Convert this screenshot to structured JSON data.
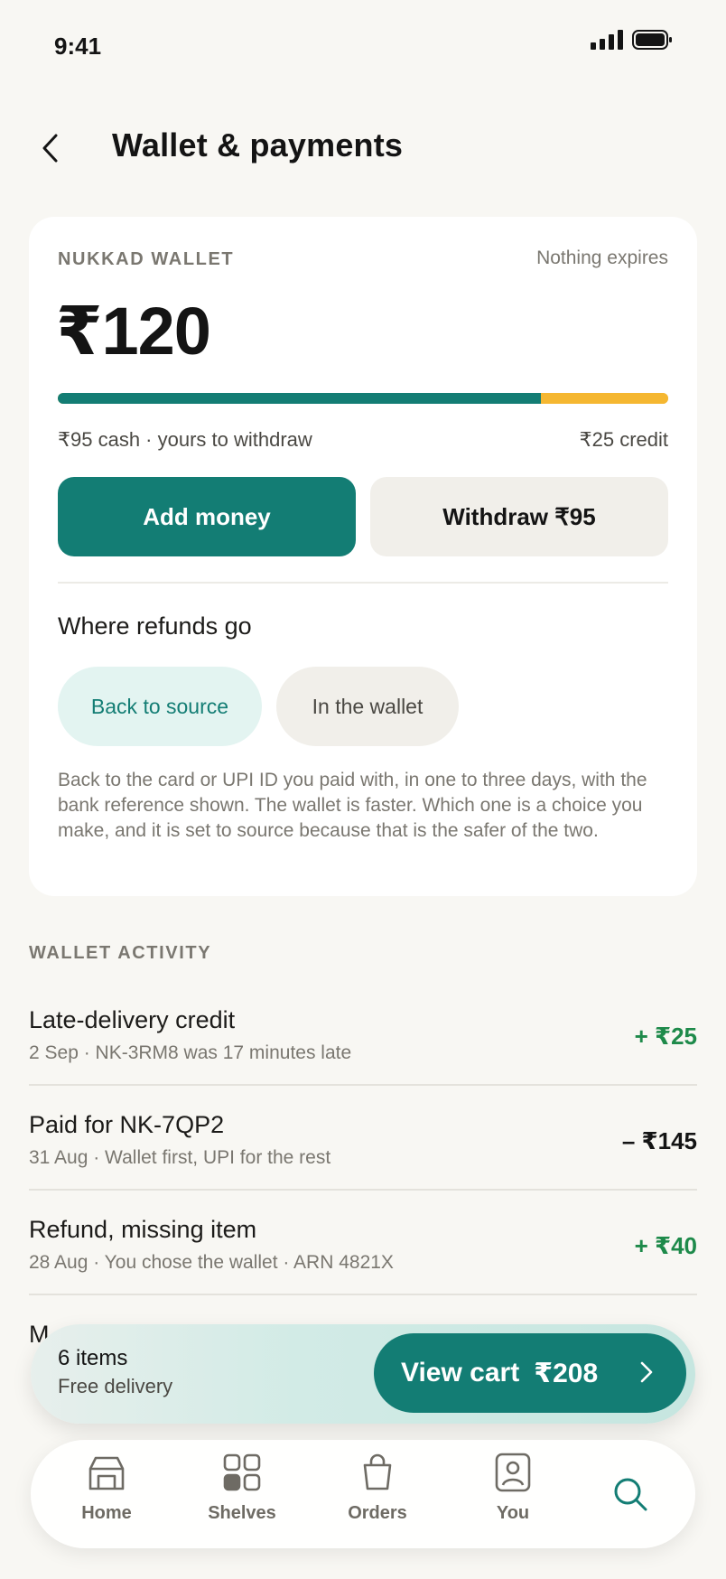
{
  "status": {
    "time": "9:41"
  },
  "header": {
    "title": "Wallet & payments"
  },
  "wallet": {
    "label": "NUKKAD WALLET",
    "expires": "Nothing expires",
    "balance": "₹120",
    "cash_fraction": 0.7917,
    "cash_label": "₹95 cash · yours to withdraw",
    "credit_label": "₹25 credit",
    "add_button": "Add money",
    "withdraw_button": "Withdraw ₹95",
    "refunds_title": "Where refunds go",
    "refund_options": [
      "Back to source",
      "In the wallet"
    ],
    "selected_refund_option": "Back to source",
    "refunds_description": "Back to the card or UPI ID you paid with, in one to three days, with the bank reference shown. The wallet is faster. Which one is a choice you make, and it is set to source because that is the safer of the two."
  },
  "activity": {
    "label": "WALLET ACTIVITY",
    "items": [
      {
        "title": "Late-delivery credit",
        "subtitle": "2 Sep · NK-3RM8 was 17 minutes late",
        "amount": "+ ₹25"
      },
      {
        "title": "Paid for NK-7QP2",
        "subtitle": "31 Aug · Wallet first, UPI for the rest",
        "amount": "– ₹145"
      },
      {
        "title": "Refund, missing item",
        "subtitle": "28 Aug · You chose the wallet · ARN 4821X",
        "amount": "+ ₹40"
      },
      {
        "title": "M",
        "subtitle": "",
        "amount": ""
      }
    ]
  },
  "cart": {
    "items": "6 items",
    "delivery": "Free delivery",
    "button_label": "View cart",
    "total": "₹208"
  },
  "tabs": [
    {
      "label": "Home",
      "icon": "store-icon"
    },
    {
      "label": "Shelves",
      "icon": "grid-icon"
    },
    {
      "label": "Orders",
      "icon": "bag-icon"
    },
    {
      "label": "You",
      "icon": "person-icon"
    }
  ],
  "colors": {
    "accent": "#137d74",
    "credit": "#f5b731",
    "positive": "#1e8a4a"
  }
}
